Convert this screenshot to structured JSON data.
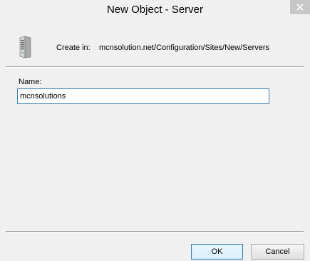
{
  "window": {
    "title": "New Object - Server",
    "close_icon": "close-icon"
  },
  "header": {
    "icon": "server-icon",
    "create_in_label": "Create in:",
    "create_in_path": "mcnsolution.net/Configuration/Sites/New/Servers"
  },
  "form": {
    "name_label": "Name:",
    "name_value": "mcnsolutions"
  },
  "buttons": {
    "ok_label": "OK",
    "cancel_label": "Cancel"
  },
  "colors": {
    "close_button_bg": "#c7c7c7",
    "input_border": "#3c7fb1",
    "dialog_bg": "#f0f0f0"
  }
}
